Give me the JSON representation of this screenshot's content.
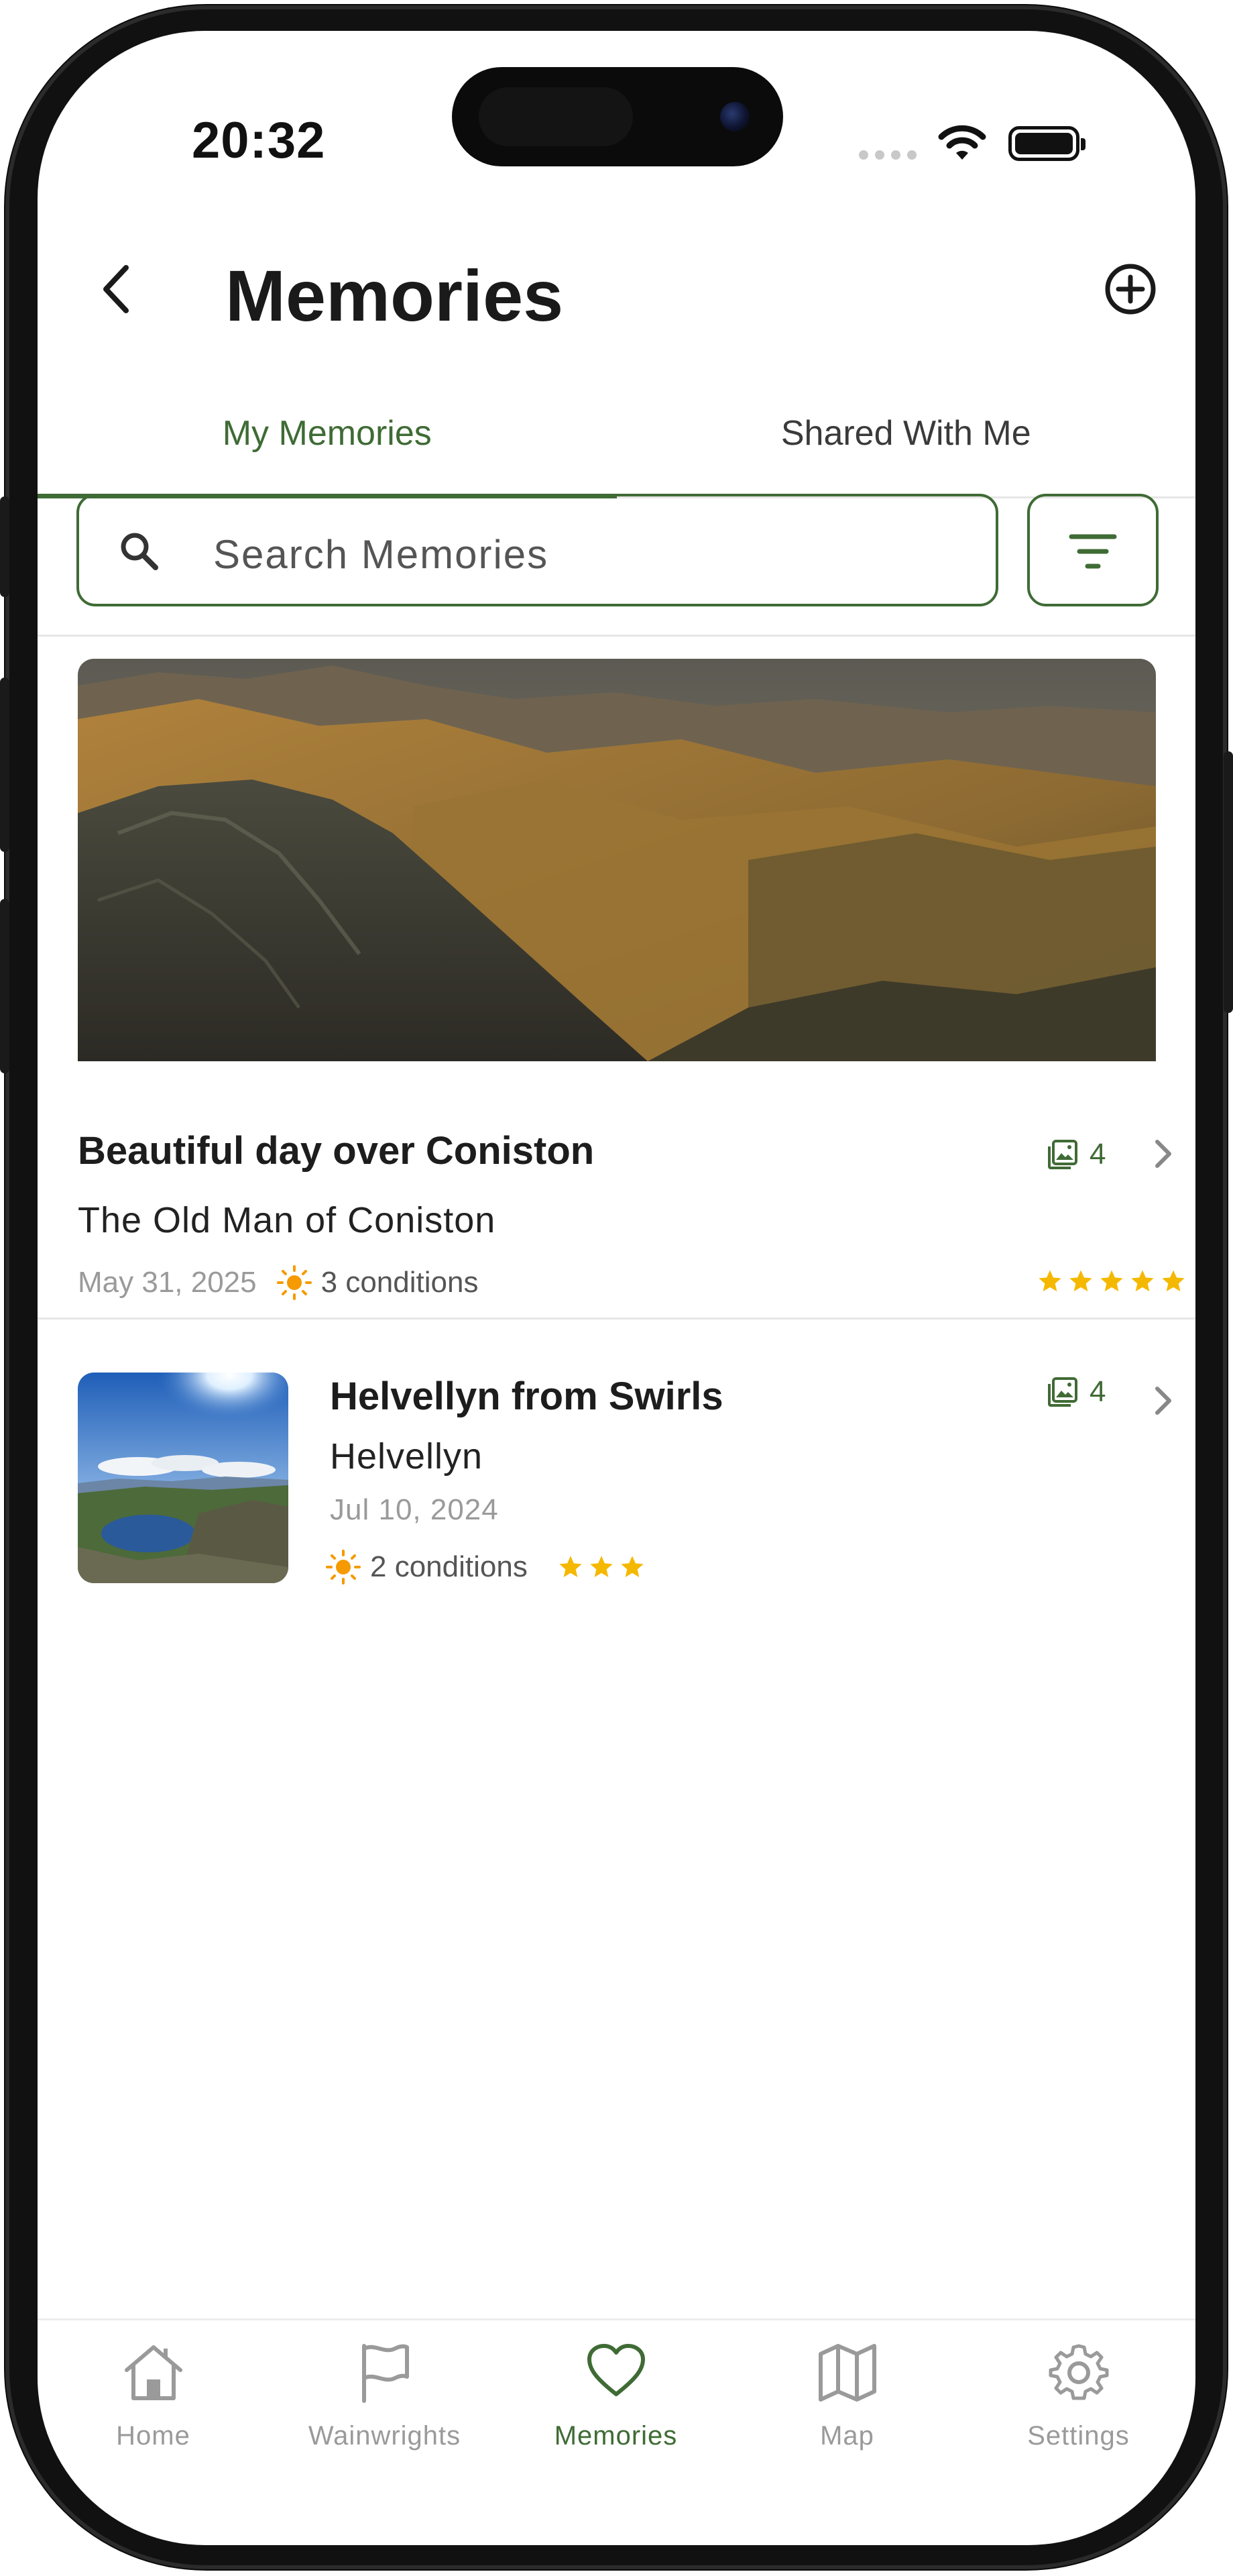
{
  "status_bar": {
    "time": "20:32"
  },
  "header": {
    "title": "Memories"
  },
  "tabs": [
    {
      "label": "My Memories",
      "active": true
    },
    {
      "label": "Shared With Me",
      "active": false
    }
  ],
  "search": {
    "placeholder": "Search Memories"
  },
  "memories": [
    {
      "title": "Beautiful day over Coniston",
      "location": "The Old Man of Coniston",
      "date": "May 31, 2025",
      "conditions": "3 conditions",
      "photo_count": "4",
      "rating": 5
    },
    {
      "title": "Helvellyn from Swirls",
      "location": "Helvellyn",
      "date": "Jul 10, 2024",
      "conditions": "2 conditions",
      "photo_count": "4",
      "rating": 3
    }
  ],
  "tab_bar": [
    {
      "label": "Home",
      "icon": "home-icon",
      "active": false
    },
    {
      "label": "Wainwrights",
      "icon": "flag-icon",
      "active": false
    },
    {
      "label": "Memories",
      "icon": "heart-icon",
      "active": true
    },
    {
      "label": "Map",
      "icon": "map-icon",
      "active": false
    },
    {
      "label": "Settings",
      "icon": "gear-icon",
      "active": false
    }
  ],
  "colors": {
    "accent": "#3f6b35",
    "star": "#f5b800",
    "sun": "#f59a00"
  }
}
